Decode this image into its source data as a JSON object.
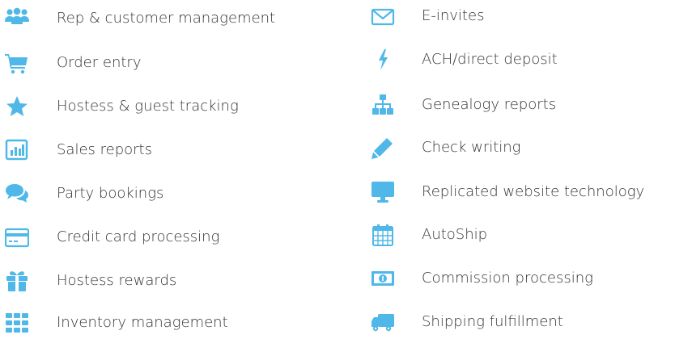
{
  "colors": {
    "accent": "#4fb8e8",
    "text": "#333333",
    "background": "#ffffff"
  },
  "features": {
    "left": [
      {
        "label": "Rep & customer management",
        "icon": "users-icon"
      },
      {
        "label": "Order entry",
        "icon": "shopping-cart-icon"
      },
      {
        "label": "Hostess & guest tracking",
        "icon": "star-icon"
      },
      {
        "label": "Sales reports",
        "icon": "bar-chart-icon"
      },
      {
        "label": "Party bookings",
        "icon": "chat-bubbles-icon"
      },
      {
        "label": "Credit card processing",
        "icon": "credit-card-icon"
      },
      {
        "label": "Hostess rewards",
        "icon": "gift-icon"
      },
      {
        "label": "Inventory management",
        "icon": "grid-icon"
      }
    ],
    "right": [
      {
        "label": "E-invites",
        "icon": "envelope-icon"
      },
      {
        "label": "ACH/direct deposit",
        "icon": "lightning-icon"
      },
      {
        "label": "Genealogy reports",
        "icon": "sitemap-icon"
      },
      {
        "label": "Check writing",
        "icon": "pencil-icon"
      },
      {
        "label": "Replicated website technology",
        "icon": "monitor-icon"
      },
      {
        "label": "AutoShip",
        "icon": "calendar-icon"
      },
      {
        "label": "Commission processing",
        "icon": "money-icon"
      },
      {
        "label": "Shipping fulfillment",
        "icon": "truck-icon"
      }
    ]
  }
}
